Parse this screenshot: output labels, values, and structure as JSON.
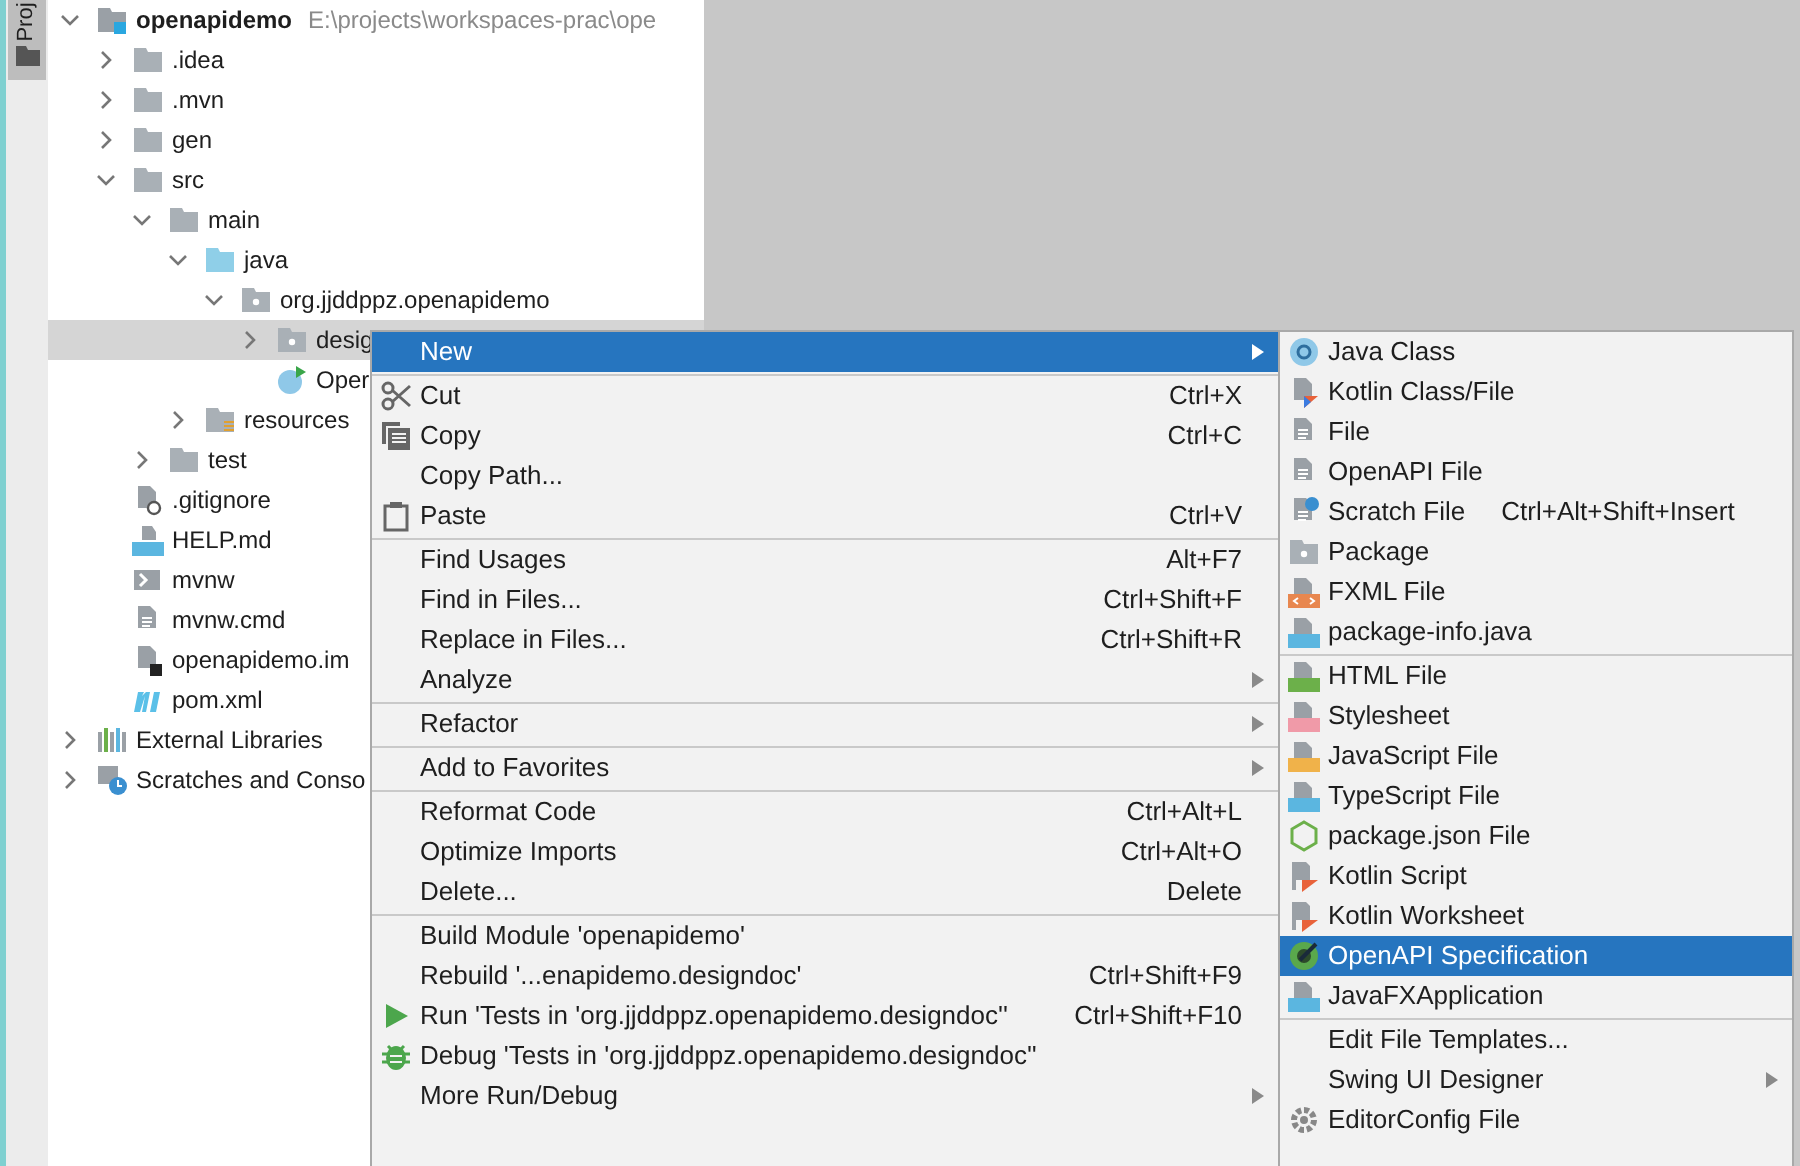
{
  "side_tab": {
    "label": "Proj"
  },
  "project_tree": [
    {
      "name": "openapidemo",
      "path": "E:\\projects\\workspaces-prac\\ope",
      "kind": "module",
      "expanded": true,
      "selected": false,
      "children": [
        {
          "name": ".idea",
          "kind": "folder",
          "expanded": false,
          "selected": false
        },
        {
          "name": ".mvn",
          "kind": "folder",
          "expanded": false,
          "selected": false
        },
        {
          "name": "gen",
          "kind": "folder",
          "expanded": false,
          "selected": false
        },
        {
          "name": "src",
          "kind": "folder",
          "expanded": true,
          "selected": false,
          "children": [
            {
              "name": "main",
              "kind": "folder",
              "expanded": true,
              "selected": false,
              "children": [
                {
                  "name": "java",
                  "kind": "source-folder",
                  "expanded": true,
                  "selected": false,
                  "children": [
                    {
                      "name": "org.jjddppz.openapidemo",
                      "kind": "package",
                      "expanded": true,
                      "selected": false,
                      "children": [
                        {
                          "name": "desig",
                          "kind": "package",
                          "expanded": false,
                          "selected": true
                        },
                        {
                          "name": "Oper",
                          "kind": "class",
                          "selected": false
                        }
                      ]
                    }
                  ]
                },
                {
                  "name": "resources",
                  "kind": "resources",
                  "expanded": false,
                  "selected": false
                }
              ]
            },
            {
              "name": "test",
              "kind": "folder",
              "expanded": false,
              "selected": false
            }
          ]
        },
        {
          "name": ".gitignore",
          "kind": "ignore",
          "selected": false
        },
        {
          "name": "HELP.md",
          "kind": "markdown",
          "selected": false
        },
        {
          "name": "mvnw",
          "kind": "shell",
          "selected": false
        },
        {
          "name": "mvnw.cmd",
          "kind": "text",
          "selected": false
        },
        {
          "name": "openapidemo.im",
          "kind": "iml",
          "selected": false
        },
        {
          "name": "pom.xml",
          "kind": "maven",
          "selected": false
        }
      ]
    },
    {
      "name": "External Libraries",
      "kind": "libraries",
      "expanded": false,
      "selected": false
    },
    {
      "name": "Scratches and Conso",
      "kind": "scratches",
      "expanded": false,
      "selected": false
    }
  ],
  "context_menu": [
    {
      "kind": "plain",
      "label": "New",
      "submenu": true,
      "selected": true
    },
    {
      "kind": "separator"
    },
    {
      "kind": "scissors",
      "label": "Cut",
      "shortcut": "Ctrl+X",
      "submenu": false,
      "selected": false
    },
    {
      "kind": "copy",
      "label": "Copy",
      "shortcut": "Ctrl+C",
      "submenu": false,
      "selected": false
    },
    {
      "kind": "plain",
      "label": "Copy Path...",
      "submenu": false,
      "selected": false
    },
    {
      "kind": "clipboard",
      "label": "Paste",
      "shortcut": "Ctrl+V",
      "submenu": false,
      "selected": false
    },
    {
      "kind": "separator"
    },
    {
      "kind": "plain",
      "label": "Find Usages",
      "shortcut": "Alt+F7",
      "submenu": false,
      "selected": false
    },
    {
      "kind": "plain",
      "label": "Find in Files...",
      "shortcut": "Ctrl+Shift+F",
      "submenu": false,
      "selected": false
    },
    {
      "kind": "plain",
      "label": "Replace in Files...",
      "shortcut": "Ctrl+Shift+R",
      "submenu": false,
      "selected": false
    },
    {
      "kind": "plain",
      "label": "Analyze",
      "submenu": true,
      "selected": false
    },
    {
      "kind": "separator"
    },
    {
      "kind": "plain",
      "label": "Refactor",
      "submenu": true,
      "selected": false
    },
    {
      "kind": "separator"
    },
    {
      "kind": "plain",
      "label": "Add to Favorites",
      "submenu": true,
      "selected": false
    },
    {
      "kind": "separator"
    },
    {
      "kind": "plain",
      "label": "Reformat Code",
      "shortcut": "Ctrl+Alt+L",
      "submenu": false,
      "selected": false
    },
    {
      "kind": "plain",
      "label": "Optimize Imports",
      "shortcut": "Ctrl+Alt+O",
      "submenu": false,
      "selected": false
    },
    {
      "kind": "plain",
      "label": "Delete...",
      "shortcut": "Delete",
      "submenu": false,
      "selected": false
    },
    {
      "kind": "separator"
    },
    {
      "kind": "plain",
      "label": "Build Module 'openapidemo'",
      "submenu": false,
      "selected": false
    },
    {
      "kind": "plain",
      "label": "Rebuild '...enapidemo.designdoc'",
      "shortcut": "Ctrl+Shift+F9",
      "submenu": false,
      "selected": false
    },
    {
      "kind": "run",
      "label": "Run 'Tests in 'org.jjddppz.openapidemo.designdoc''",
      "shortcut": "Ctrl+Shift+F10",
      "submenu": false,
      "selected": false
    },
    {
      "kind": "debug",
      "label": "Debug 'Tests in 'org.jjddppz.openapidemo.designdoc''",
      "submenu": false,
      "selected": false
    },
    {
      "kind": "plain",
      "label": "More Run/Debug",
      "submenu": true,
      "selected": false
    }
  ],
  "new_submenu": [
    {
      "kind": "java-class",
      "label": "Java Class",
      "submenu": false,
      "selected": false
    },
    {
      "kind": "kotlin-file",
      "label": "Kotlin Class/File",
      "submenu": false,
      "selected": false
    },
    {
      "kind": "text",
      "label": "File",
      "submenu": false,
      "selected": false
    },
    {
      "kind": "text",
      "label": "OpenAPI File",
      "submenu": false,
      "selected": false
    },
    {
      "kind": "scratch",
      "label": "Scratch File",
      "shortcut": "Ctrl+Alt+Shift+Insert",
      "submenu": false,
      "selected": false
    },
    {
      "kind": "package",
      "label": "Package",
      "submenu": false,
      "selected": false
    },
    {
      "kind": "fxml",
      "label": "FXML File",
      "submenu": false,
      "selected": false
    },
    {
      "kind": "java-file",
      "label": "package-info.java",
      "submenu": false,
      "selected": false
    },
    {
      "kind": "separator"
    },
    {
      "kind": "html",
      "label": "HTML File",
      "submenu": false,
      "selected": false
    },
    {
      "kind": "css",
      "label": "Stylesheet",
      "submenu": false,
      "selected": false
    },
    {
      "kind": "js",
      "label": "JavaScript File",
      "submenu": false,
      "selected": false
    },
    {
      "kind": "ts",
      "label": "TypeScript File",
      "submenu": false,
      "selected": false
    },
    {
      "kind": "node",
      "label": "package.json File",
      "submenu": false,
      "selected": false
    },
    {
      "kind": "kotlin-script",
      "label": "Kotlin Script",
      "submenu": false,
      "selected": false
    },
    {
      "kind": "kotlin-script",
      "label": "Kotlin Worksheet",
      "submenu": false,
      "selected": false
    },
    {
      "kind": "openapi",
      "label": "OpenAPI Specification",
      "submenu": false,
      "selected": true
    },
    {
      "kind": "java-file",
      "label": "JavaFXApplication",
      "submenu": false,
      "selected": false
    },
    {
      "kind": "separator"
    },
    {
      "kind": "plain",
      "label": "Edit File Templates...",
      "submenu": false,
      "selected": false
    },
    {
      "kind": "plain",
      "label": "Swing UI Designer",
      "submenu": true,
      "selected": false
    },
    {
      "kind": "gear",
      "label": "EditorConfig File",
      "submenu": false,
      "selected": false
    }
  ]
}
